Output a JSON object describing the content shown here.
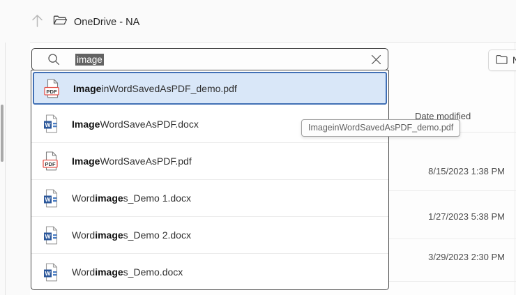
{
  "breadcrumb": {
    "label": "OneDrive - NA"
  },
  "search": {
    "value": "image",
    "selected": true
  },
  "toolbar": {
    "new_button_label": "N"
  },
  "dropdown": {
    "items": [
      {
        "icon": "pdf",
        "selected": true,
        "segments": [
          {
            "t": "Image",
            "b": true
          },
          {
            "t": "inWordSavedAsPDF_demo.pdf",
            "b": false
          }
        ]
      },
      {
        "icon": "word",
        "selected": false,
        "segments": [
          {
            "t": "Image",
            "b": true
          },
          {
            "t": "WordSaveAsPDF.docx",
            "b": false
          }
        ]
      },
      {
        "icon": "pdf",
        "selected": false,
        "segments": [
          {
            "t": "Image",
            "b": true
          },
          {
            "t": "WordSaveAsPDF.pdf",
            "b": false
          }
        ]
      },
      {
        "icon": "word",
        "selected": false,
        "segments": [
          {
            "t": "Word",
            "b": false
          },
          {
            "t": "image",
            "b": true
          },
          {
            "t": "s_Demo 1.docx",
            "b": false
          }
        ]
      },
      {
        "icon": "word",
        "selected": false,
        "segments": [
          {
            "t": "Word",
            "b": false
          },
          {
            "t": "image",
            "b": true
          },
          {
            "t": "s_Demo 2.docx",
            "b": false
          }
        ]
      },
      {
        "icon": "word",
        "selected": false,
        "segments": [
          {
            "t": "Word",
            "b": false
          },
          {
            "t": "image",
            "b": true
          },
          {
            "t": "s_Demo.docx",
            "b": false
          }
        ]
      }
    ]
  },
  "tooltip": {
    "text": "ImageinWordSavedAsPDF_demo.pdf"
  },
  "file_list": {
    "columns": [
      {
        "label": "Date modified"
      }
    ],
    "dates": [
      "8/15/2023 1:38 PM",
      "1/27/2023 5:38 PM",
      "3/29/2023 2:30 PM"
    ]
  },
  "icons": {
    "up_arrow": "up-arrow-icon",
    "breadcrumb_folder": "open-folder-icon",
    "search": "search-icon",
    "clear": "close-icon",
    "new_folder": "folder-icon",
    "pdf_file": "pdf-file-icon",
    "word_file": "word-file-icon"
  },
  "colors": {
    "selection_border": "#4170b5",
    "selection_bg": "#d9e7f8",
    "pdf_red": "#e5544c",
    "word_blue": "#2b579a",
    "text_selection_bg": "#636363"
  }
}
